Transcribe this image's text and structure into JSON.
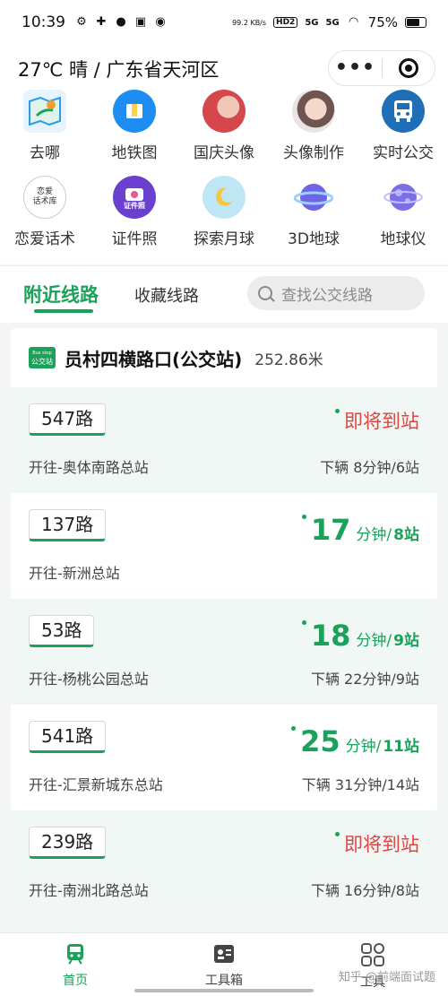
{
  "status_bar": {
    "time": "10:39",
    "icons": [
      "gear-icon",
      "app-icon",
      "chat-icon",
      "game-icon",
      "lens-icon"
    ],
    "net_speed": "99.2 KB/s",
    "hd_tag": "HD2",
    "signal_1": "5G",
    "signal_2": "5G",
    "battery": "75%",
    "battery_level": 0.75
  },
  "header": {
    "weather": "27℃ 晴 / 广东省天河区",
    "menu": "•••"
  },
  "grid": [
    [
      {
        "label": "去哪",
        "icon": "map-pin-icon",
        "color": "#2e9be6"
      },
      {
        "label": "地铁图",
        "icon": "metro-map-icon",
        "color": "#1d8df2"
      },
      {
        "label": "国庆头像",
        "icon": "avatar-photo-icon",
        "color": "#d6474c"
      },
      {
        "label": "头像制作",
        "icon": "avatar-photo-icon",
        "color": "#c9a7a0"
      },
      {
        "label": "实时公交",
        "icon": "bus-icon",
        "color": "#1f6fb8",
        "badge": "BUS"
      }
    ],
    [
      {
        "label": "恋爱话术",
        "icon": "love-book-icon",
        "color": "#ffffff",
        "badge_lines": [
          "恋爱",
          "话术库"
        ]
      },
      {
        "label": "证件照",
        "icon": "camera-icon",
        "color": "#6b3fcf",
        "badge": "证件照"
      },
      {
        "label": "探索月球",
        "icon": "moon-icon",
        "color": "#bfe6f5"
      },
      {
        "label": "3D地球",
        "icon": "planet-icon",
        "color": "#6f63e6"
      },
      {
        "label": "地球仪",
        "icon": "globe-icon",
        "color": "#7b6fe8"
      }
    ]
  ],
  "tabs": {
    "active": "附近线路",
    "other": "收藏线路",
    "search_placeholder": "查找公交线路"
  },
  "stop": {
    "badge_top": "Bus stop",
    "badge_bottom": "公交站",
    "name": "员村四横路口(公交站)",
    "distance": "252.86米"
  },
  "routes": [
    {
      "number": "547路",
      "direction": "开往-奥体南路总站",
      "status": "即将到站",
      "minutes": null,
      "stops": null,
      "next": "下辆 8分钟/6站"
    },
    {
      "number": "137路",
      "direction": "开往-新洲总站",
      "status": null,
      "minutes": "17",
      "stops": "8站",
      "next": ""
    },
    {
      "number": "53路",
      "direction": "开往-杨桃公园总站",
      "status": null,
      "minutes": "18",
      "stops": "9站",
      "next": "下辆 22分钟/9站"
    },
    {
      "number": "541路",
      "direction": "开往-汇景新城东总站",
      "status": null,
      "minutes": "25",
      "stops": "11站",
      "next": "下辆 31分钟/14站"
    },
    {
      "number": "239路",
      "direction": "开往-南洲北路总站",
      "status": "即将到站",
      "minutes": null,
      "stops": null,
      "next": "下辆 16分钟/8站"
    }
  ],
  "labels": {
    "minute_unit": "分钟/"
  },
  "bottom_nav": {
    "home": "首页",
    "toolbox": "工具箱",
    "third": "工具",
    "watermark": "知乎 @前端面试题"
  },
  "colors": {
    "accent": "#1aa15a",
    "arriving": "#e2433f"
  }
}
